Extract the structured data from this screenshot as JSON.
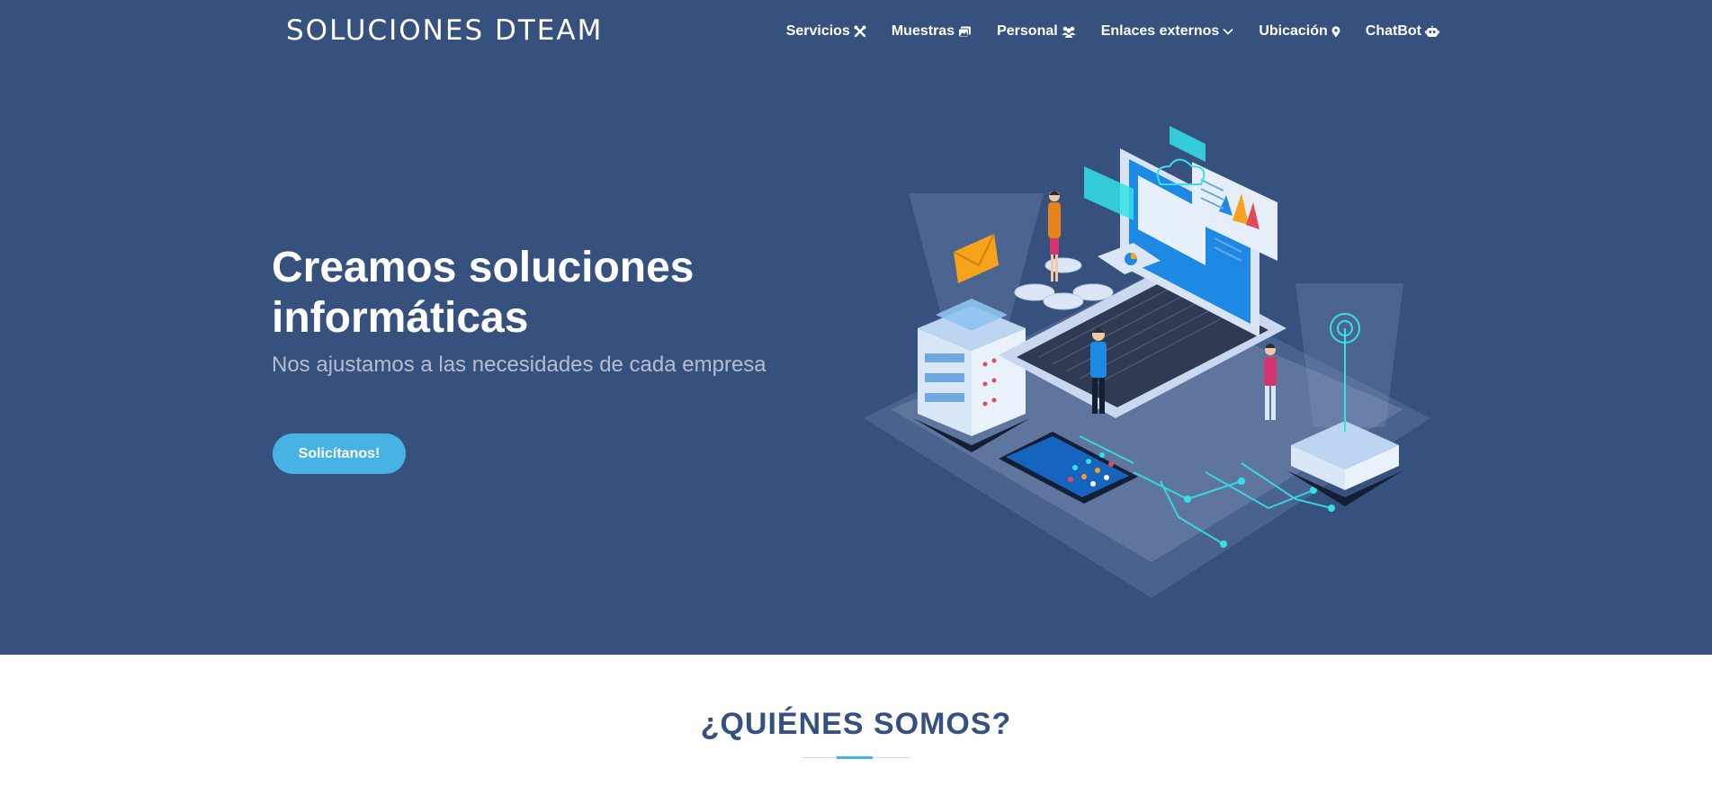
{
  "header": {
    "brand": "SOLUCIONES DTEAM",
    "nav": [
      {
        "label": "Servicios",
        "icon": "tools-icon"
      },
      {
        "label": "Muestras",
        "icon": "images-icon"
      },
      {
        "label": "Personal",
        "icon": "people-icon"
      },
      {
        "label": "Enlaces externos",
        "icon": "chevron-down-icon"
      },
      {
        "label": "Ubicación",
        "icon": "location-pin-icon"
      },
      {
        "label": "ChatBot",
        "icon": "robot-icon"
      }
    ]
  },
  "hero": {
    "headline": "Creamos soluciones informáticas",
    "subheadline": "Nos ajustamos a las necesidades de cada empresa",
    "cta": "Solicítanos!",
    "illustration": "isometric-tech-illustration"
  },
  "about": {
    "title": "¿QUIÉNES SOMOS?"
  },
  "colors": {
    "hero_bg": "#37517e",
    "accent": "#47b2e4",
    "white": "#ffffff"
  }
}
